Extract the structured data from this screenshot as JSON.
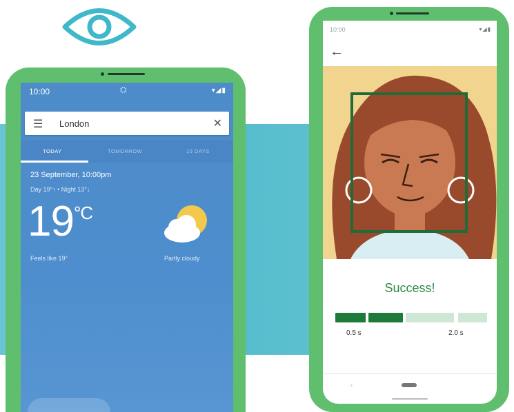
{
  "colors": {
    "phone_frame": "#5fbf6e",
    "teal_band": "#56bccd",
    "weather_bg": "#4d8bc9",
    "success_green": "#2f8a44",
    "progress_dark": "#1e7a3a",
    "progress_light": "#cfe7d5",
    "eye_icon": "#3fb8c9"
  },
  "weather": {
    "status_time": "10:00",
    "search_query": "London",
    "tabs": [
      "TODAY",
      "TOMORROW",
      "10 DAYS"
    ],
    "date": "23 September, 10:00pm",
    "day_night": "Day 19°↑ • Night 13°↓",
    "temperature": "19",
    "unit": "°C",
    "feels_like": "Feels like 19°",
    "condition": "Partly cloudy",
    "icons": [
      "menu-icon",
      "close-icon",
      "partly-cloudy-icon"
    ]
  },
  "auth": {
    "status_time": "10:00",
    "result": "Success!",
    "progress_filled_segments": 2,
    "progress_total_segments": 4,
    "time_label_left": "0.5 s",
    "time_label_right": "2.0 s",
    "icons": [
      "back-arrow-icon",
      "face-scan-frame-icon"
    ]
  }
}
